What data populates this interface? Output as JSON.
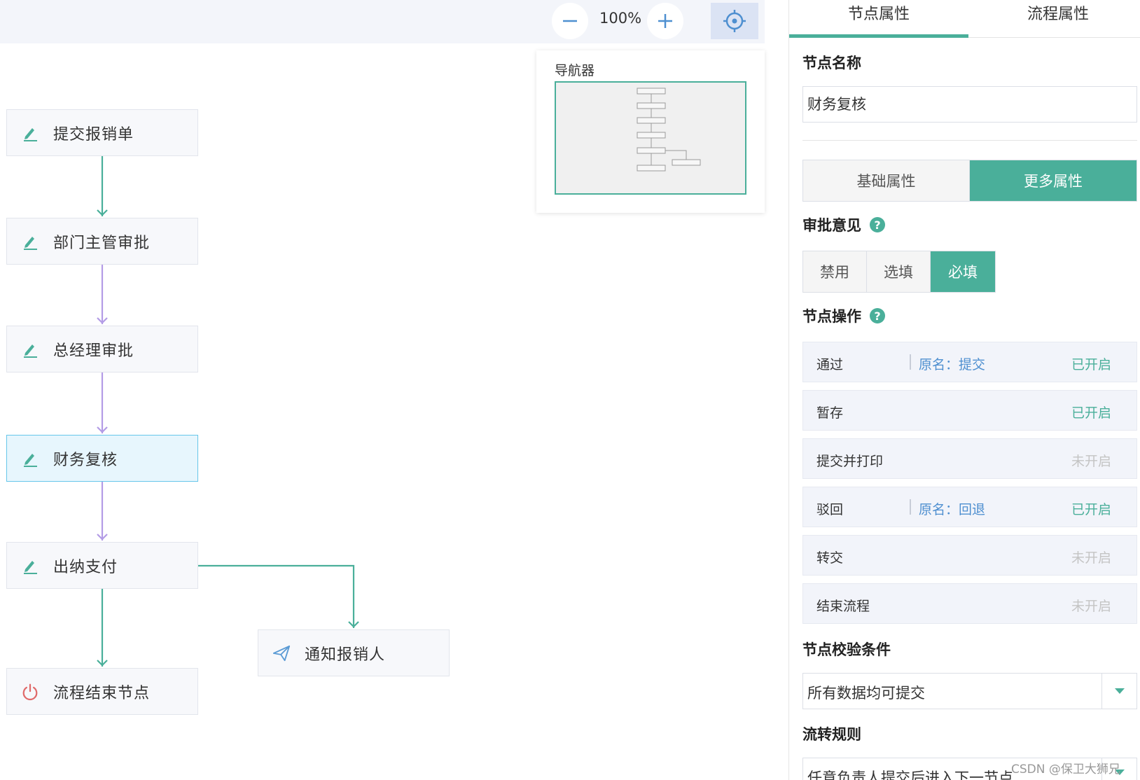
{
  "toolbar": {
    "zoom_level": "100%",
    "zoom_out_icon": "minus-icon",
    "zoom_in_icon": "plus-icon",
    "locate_icon": "crosshair-icon"
  },
  "navigator": {
    "title": "导航器"
  },
  "flow": {
    "nodes": [
      {
        "label": "提交报销单",
        "icon": "edit-icon"
      },
      {
        "label": "部门主管审批",
        "icon": "edit-icon"
      },
      {
        "label": "总经理审批",
        "icon": "edit-icon"
      },
      {
        "label": "财务复核",
        "icon": "edit-icon",
        "active": true
      },
      {
        "label": "出纳支付",
        "icon": "edit-icon"
      },
      {
        "label": "流程结束节点",
        "icon": "power-icon"
      },
      {
        "label": "通知报销人",
        "icon": "send-icon"
      }
    ]
  },
  "panel": {
    "tabs": [
      "节点属性",
      "流程属性"
    ],
    "active_tab": 0,
    "node_name": {
      "label": "节点名称",
      "value": "财务复核"
    },
    "prop_tabs": [
      "基础属性",
      "更多属性"
    ],
    "approval_opinion": {
      "label": "审批意见",
      "options": [
        "禁用",
        "选填",
        "必填"
      ],
      "selected": "必填"
    },
    "operations": {
      "label": "节点操作",
      "rows": [
        {
          "name": "通过",
          "original": "原名：提交",
          "status": "已开启",
          "enabled": true
        },
        {
          "name": "暂存",
          "original": "",
          "status": "已开启",
          "enabled": true
        },
        {
          "name": "提交并打印",
          "original": "",
          "status": "未开启",
          "enabled": false
        },
        {
          "name": "驳回",
          "original": "原名：回退",
          "status": "已开启",
          "enabled": true
        },
        {
          "name": "转交",
          "original": "",
          "status": "未开启",
          "enabled": false
        },
        {
          "name": "结束流程",
          "original": "",
          "status": "未开启",
          "enabled": false
        }
      ]
    },
    "validation": {
      "label": "节点校验条件",
      "value": "所有数据均可提交"
    },
    "transfer_rule": {
      "label": "流转规则",
      "value": "任意负责人提交后进入下一节点"
    }
  },
  "watermark": "CSDN @保卫大狮兄",
  "colors": {
    "accent": "#4aaf9a",
    "edge_purple": "#b39ce6",
    "link_blue": "#4e8fd0",
    "active_node": "#e7f6fd"
  }
}
